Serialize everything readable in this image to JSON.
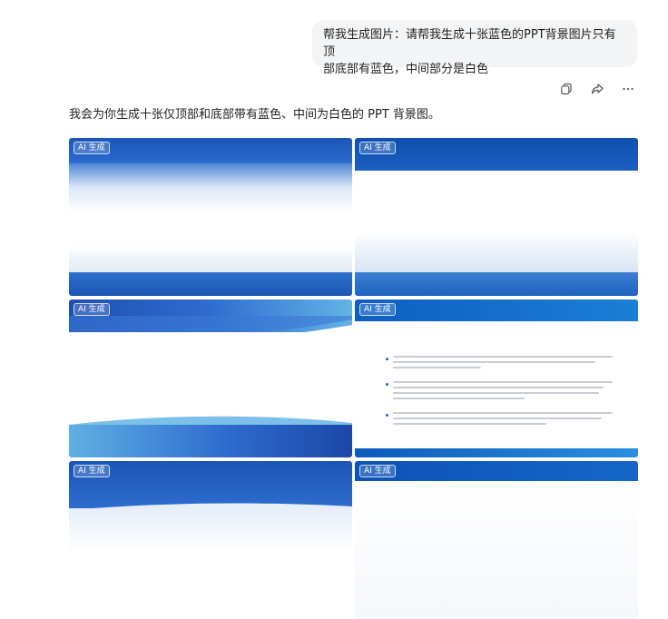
{
  "prompt": {
    "text": "帮我生成图片：请帮我生成十张蓝色的PPT背景图片只有顶部底部有蓝色，中间部分是白色",
    "line1": "帮我生成图片：请帮我生成十张蓝色的PPT背景图片只有顶",
    "line2": "部底部有蓝色，中间部分是白色"
  },
  "actions": [
    "copy-icon",
    "share-icon",
    "more-icon"
  ],
  "reply": "我会为你生成十张仅顶部和底部带有蓝色、中间为白色的 PPT 背景图。",
  "images": {
    "badge": "AI 生成",
    "count_visible": 6
  },
  "colors": {
    "primary_blue": "#1a56b8",
    "bubble_bg": "#f3f4f6"
  }
}
